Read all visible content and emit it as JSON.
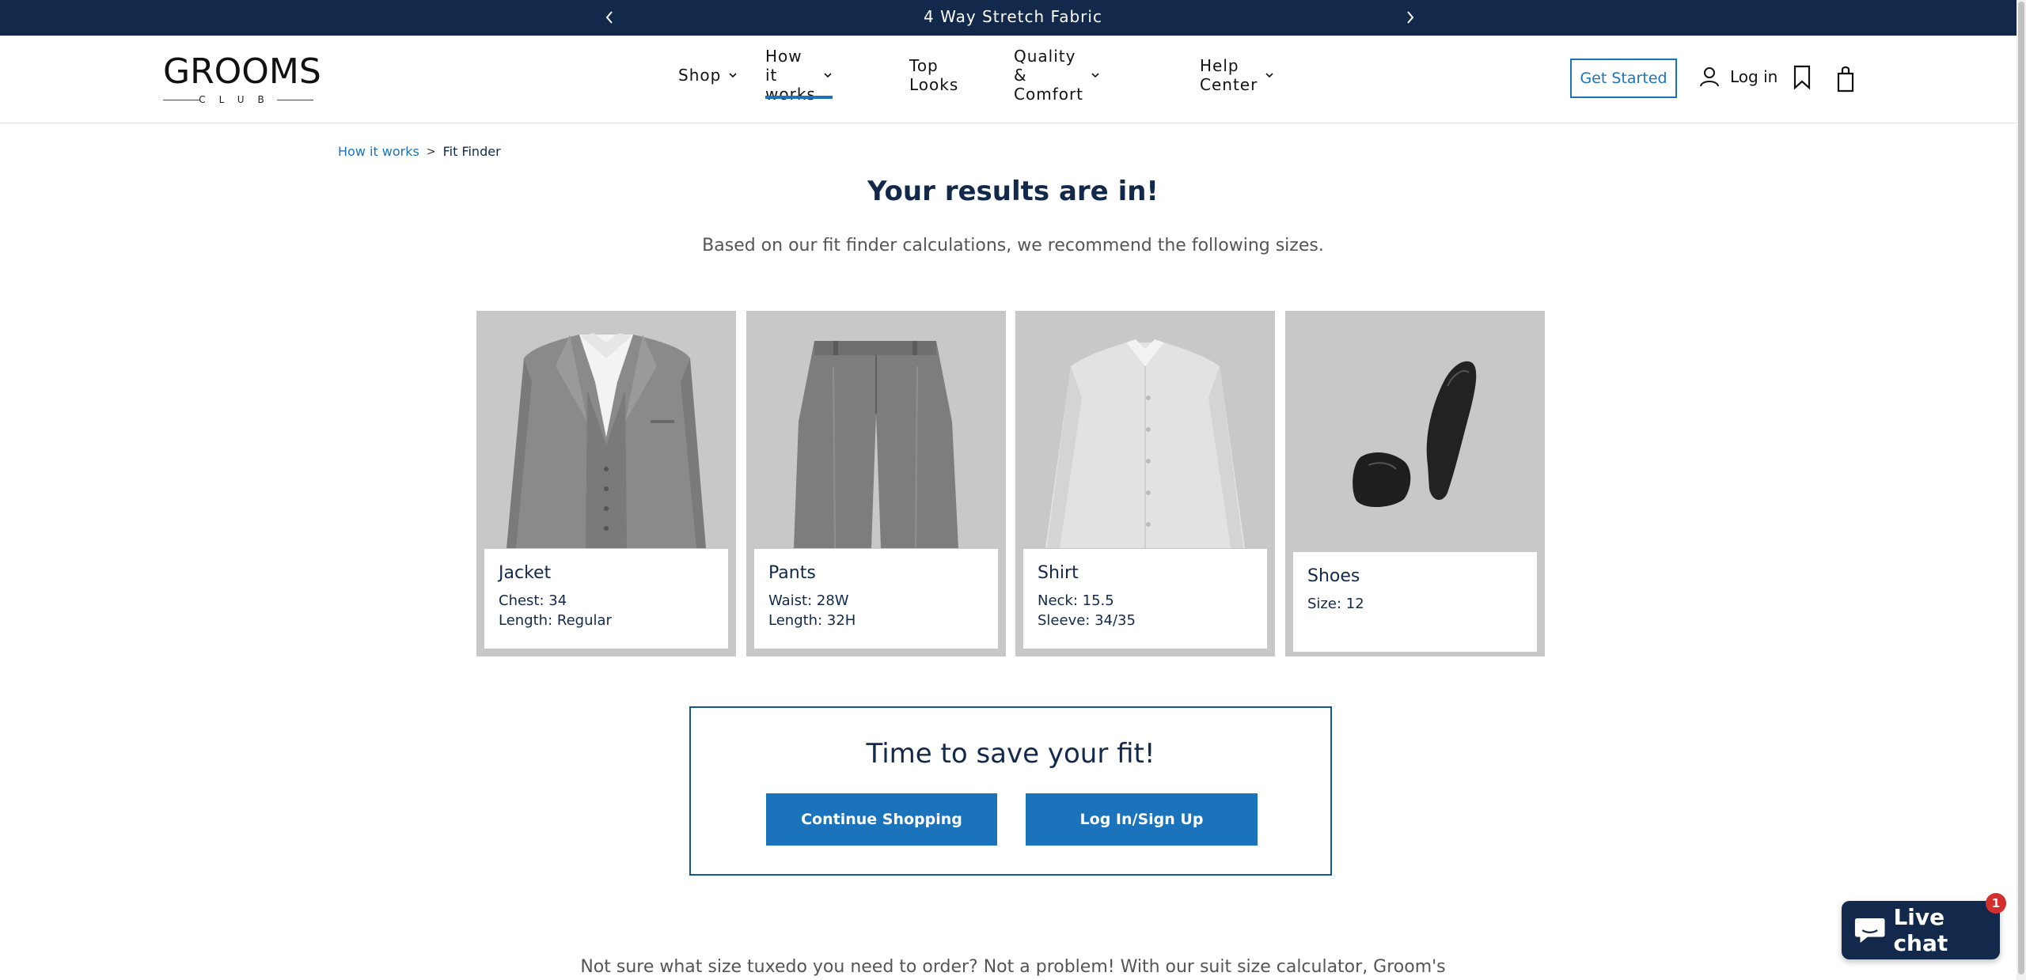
{
  "announcement": {
    "message": "4 Way Stretch Fabric",
    "prev_icon": "chevron-left-icon",
    "next_icon": "chevron-right-icon"
  },
  "header": {
    "logo_text": "GROOMS",
    "logo_sub": "CLUB",
    "nav": [
      {
        "label": "Shop",
        "has_dropdown": true,
        "active": false
      },
      {
        "label": "How it works",
        "has_dropdown": true,
        "active": true
      },
      {
        "label": "Top Looks",
        "has_dropdown": false,
        "active": false
      },
      {
        "label": "Quality & Comfort",
        "has_dropdown": true,
        "active": false
      },
      {
        "label": "Help Center",
        "has_dropdown": true,
        "active": false
      }
    ],
    "get_started_label": "Get Started",
    "login_label": "Log in",
    "icons": [
      "user-icon",
      "bookmark-icon",
      "shopping-bag-icon"
    ]
  },
  "breadcrumb": {
    "parent": "How it works",
    "separator": ">",
    "current": "Fit Finder"
  },
  "results": {
    "title": "Your results are in!",
    "subtitle": "Based on our fit finder calculations, we recommend the following sizes."
  },
  "cards": [
    {
      "name": "Jacket",
      "lines": [
        "Chest: 34",
        "Length: Regular"
      ]
    },
    {
      "name": "Pants",
      "lines": [
        "Waist: 28W",
        "Length: 32H"
      ]
    },
    {
      "name": "Shirt",
      "lines": [
        "Neck: 15.5",
        "Sleeve: 34/35"
      ]
    },
    {
      "name": "Shoes",
      "lines": [
        "Size: 12"
      ]
    }
  ],
  "save_fit": {
    "title": "Time to save your fit!",
    "continue_label": "Continue Shopping",
    "login_label": "Log In/Sign Up"
  },
  "bottom_text": "Not sure what size tuxedo you need to order? Not a problem! With our suit size calculator, Groom's",
  "live_chat": {
    "label": "Live chat",
    "badge": "1"
  },
  "colors": {
    "navy": "#13294b",
    "accent_blue": "#1a73bb",
    "card_bg": "#c8c8c8"
  }
}
